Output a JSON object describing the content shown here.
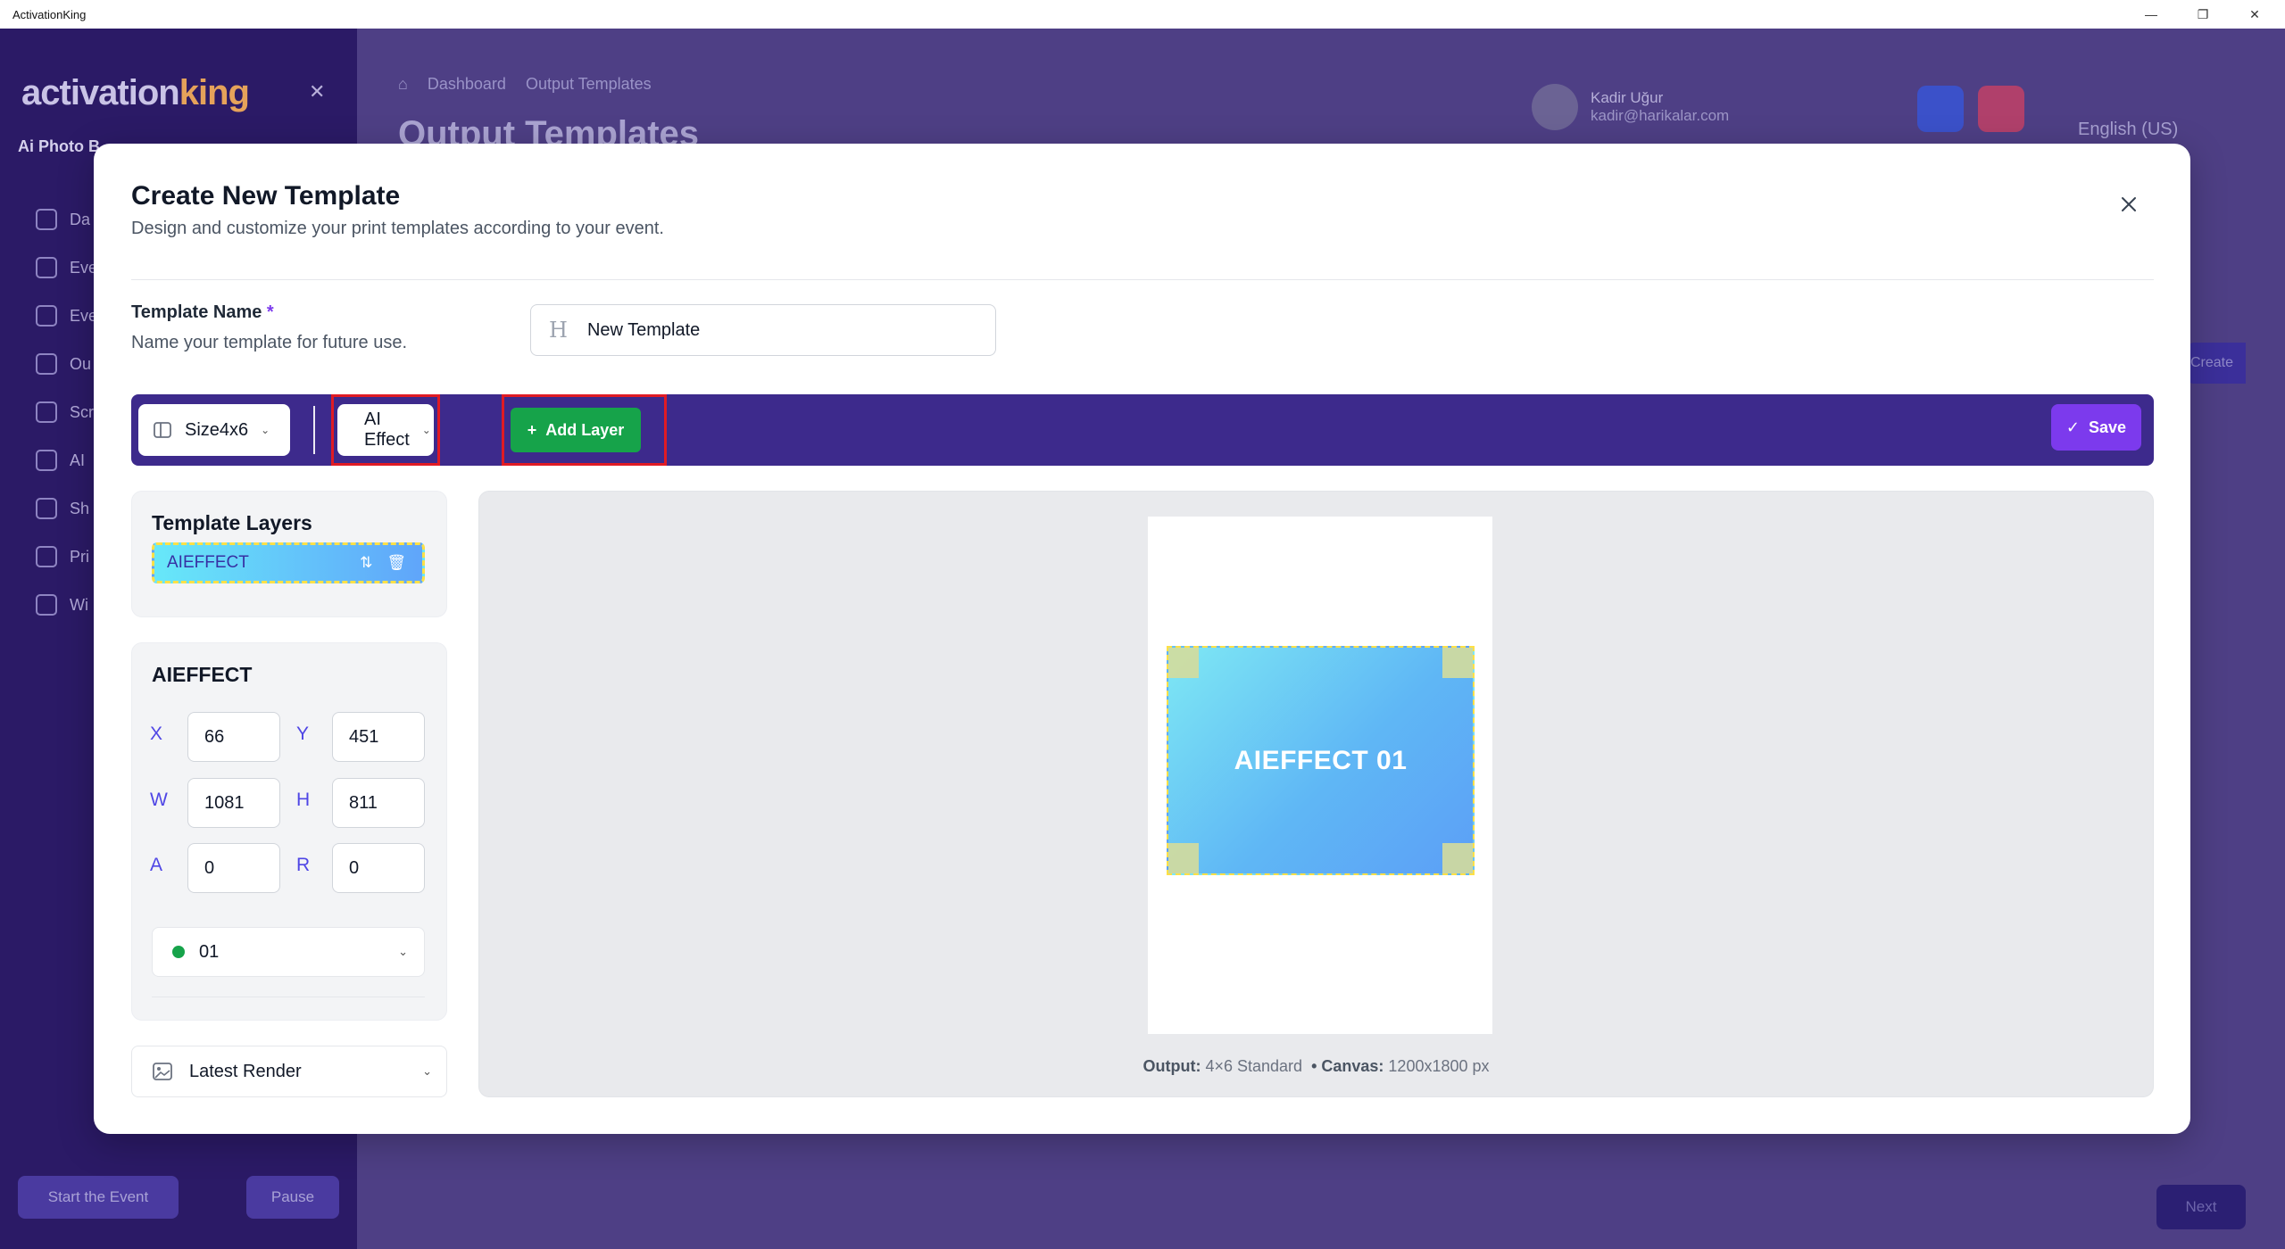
{
  "window": {
    "title": "ActivationKing",
    "minimize": "—",
    "restore": "❐",
    "close": "✕"
  },
  "background": {
    "logo_main": "activation",
    "logo_accent": "king",
    "app_title": "Ai Photo B",
    "nav_items": [
      "Da",
      "Eve",
      "Eve",
      "Ou",
      "Scr",
      "AI",
      "Sh",
      "Pri",
      "Wi"
    ],
    "start_button": "Start the Event",
    "pause_button": "Pause",
    "breadcrumb": [
      "Dashboard",
      "Output Templates"
    ],
    "page_title": "Output Templates",
    "user_name": "Kadir Uğur",
    "user_email": "kadir@harikalar.com",
    "language": "English (US)",
    "create_button": "Create",
    "next_button": "Next"
  },
  "modal": {
    "title": "Create New Template",
    "subtitle": "Design and customize your print templates according to your event.",
    "template_name_label": "Template Name",
    "template_name_required": "*",
    "template_name_hint": "Name your template for future use.",
    "template_name_value": "New Template"
  },
  "toolbar": {
    "size_label": "Size4x6",
    "layer_type_label": "AI Effect",
    "add_layer_label": "Add Layer",
    "save_label": "Save",
    "highlight_color": "#e01b24"
  },
  "layers": {
    "title": "Template Layers",
    "items": [
      {
        "name": "AIEFFECT"
      }
    ]
  },
  "properties": {
    "title": "AIEFFECT",
    "x_label": "X",
    "x_value": "66",
    "y_label": "Y",
    "y_value": "451",
    "w_label": "W",
    "w_value": "1081",
    "h_label": "H",
    "h_value": "811",
    "a_label": "A",
    "a_value": "0",
    "r_label": "R",
    "r_value": "0",
    "effect_select": "01"
  },
  "render_select": "Latest Render",
  "canvas": {
    "layer_text": "AIEFFECT 01",
    "output_label": "Output:",
    "output_value": "4×6 Standard",
    "canvas_label": "• Canvas:",
    "canvas_value": "1200x1800 px"
  }
}
